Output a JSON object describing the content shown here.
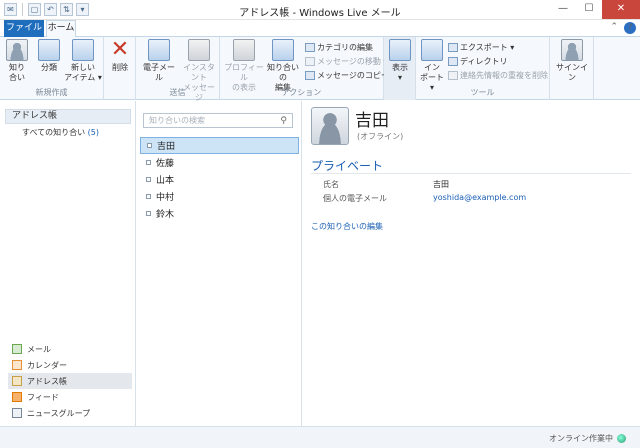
{
  "window": {
    "title": "アドレス帳 - Windows Live メール",
    "minimize": "—",
    "maximize": "☐",
    "close": "✕"
  },
  "tabs": {
    "file": "ファイル",
    "home": "ホーム",
    "help": "?"
  },
  "ribbon": {
    "new": {
      "title": "新規作成",
      "contact": "知り合い",
      "category": "分類",
      "new_items": "新しいアイテム",
      "contact_l1": "知り",
      "contact_l2": "合い",
      "new_l1": "新しい",
      "new_l2": "アイテム ▾"
    },
    "delete": "削除",
    "send": {
      "title": "送信",
      "email": "電子メール",
      "im_l1": "インスタント",
      "im_l2": "メッセージ"
    },
    "actions": {
      "title": "アクション",
      "profile_l1": "プロフィール",
      "profile_l2": "の表示",
      "edit_l1": "知り合いの",
      "edit_l2": "編集",
      "edit_category": "カテゴリの編集",
      "move_message": "メッセージの移動 ▾",
      "copy_message": "メッセージのコピー ▾"
    },
    "view": {
      "label": "表示",
      "sub": "▾"
    },
    "tools": {
      "title": "ツール",
      "import_l1": "イン",
      "import_l2": "ポート ▾",
      "export": "エクスポート ▾",
      "directory": "ディレクトリ",
      "clear_dupes": "連絡先情報の重複を削除"
    },
    "signin": "サインイン"
  },
  "sidebar": {
    "header": "アドレス帳",
    "all_contacts": "すべての知り合い",
    "all_count": "(5)",
    "nav": [
      {
        "label": "メール",
        "color": "#6aa84f"
      },
      {
        "label": "カレンダー",
        "color": "#e69138"
      },
      {
        "label": "アドレス帳",
        "color": "#c9a04a"
      },
      {
        "label": "フィード",
        "color": "#e07b00"
      },
      {
        "label": "ニュースグループ",
        "color": "#7a8796"
      }
    ]
  },
  "contacts": {
    "search_placeholder": "知り合いの検索",
    "items": [
      "吉田",
      "佐藤",
      "山本",
      "中村",
      "鈴木"
    ]
  },
  "detail": {
    "name": "吉田",
    "status": "(オフライン)",
    "section": "プライベート",
    "fields": [
      {
        "label": "氏名",
        "value": "吉田"
      },
      {
        "label": "個人の電子メール",
        "value": "yoshida@example.com"
      }
    ],
    "edit_link": "この知り合いの編集"
  },
  "statusbar": {
    "text": "オンライン作業中"
  }
}
